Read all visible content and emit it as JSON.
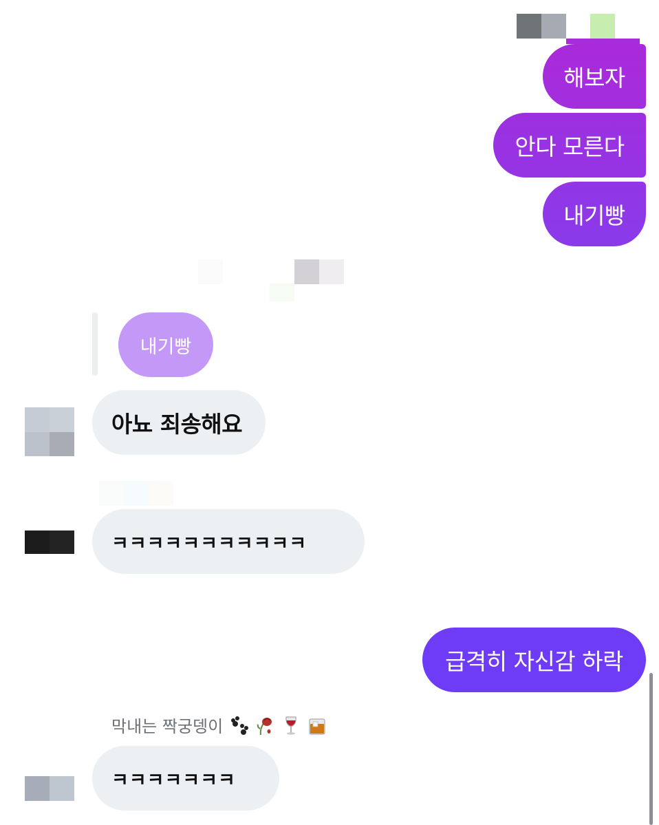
{
  "colors": {
    "bubble_out_gradient": [
      "#a72cdc",
      "#7c3df2"
    ],
    "bubble_out_last": "#6f3bf7",
    "bubble_in": "#edf0f3",
    "reply_bubble": "#c498f6"
  },
  "messages_out_top": [
    {
      "text": "해보자"
    },
    {
      "text": "안다 모른다"
    },
    {
      "text": "내기빵"
    }
  ],
  "reply": {
    "quoted_text": "내기빵"
  },
  "messages_in": [
    {
      "text": "아뇨 죄송해요"
    },
    {
      "text": "ㅋㅋㅋㅋㅋㅋㅋㅋㅋㅋㅋ"
    }
  ],
  "message_out_bottom": {
    "text": "급격히 자신감 하락"
  },
  "sender": {
    "name": "막내는 짝궁뎅이",
    "emoji_icons": [
      "paw-prints-icon",
      "wilted-rose-icon",
      "wine-glass-icon",
      "whisky-glass-icon"
    ]
  },
  "message_in_last": {
    "text": "ㅋㅋㅋㅋㅋㅋㅋ"
  }
}
